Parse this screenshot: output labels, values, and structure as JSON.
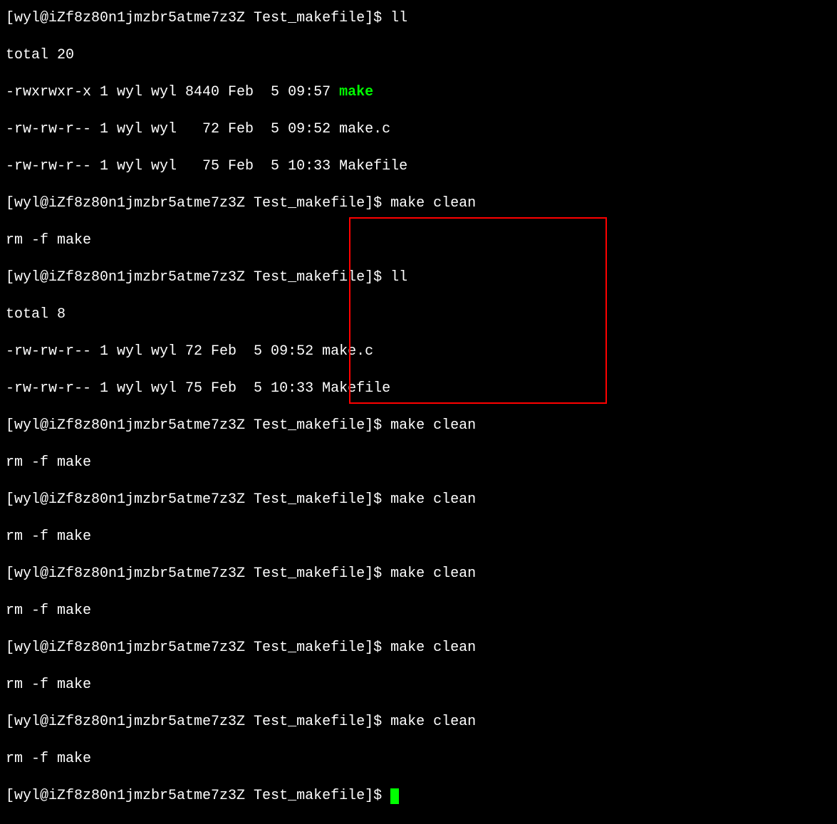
{
  "lines": {
    "l0_partial": "[wyl@iZf8z80n1jmzbr5atme7z3Z Test_makefile]$ ll",
    "l1": "total 20",
    "l2_perm": "-rwxrwxr-x 1 wyl wyl 8440 Feb  5 09:57 ",
    "l2_file": "make",
    "l3": "-rw-rw-r-- 1 wyl wyl   72 Feb  5 09:52 make.c",
    "l4": "-rw-rw-r-- 1 wyl wyl   75 Feb  5 10:33 Makefile",
    "l5": "[wyl@iZf8z80n1jmzbr5atme7z3Z Test_makefile]$ make clean",
    "l6": "rm -f make",
    "l7": "[wyl@iZf8z80n1jmzbr5atme7z3Z Test_makefile]$ ll",
    "l8": "total 8",
    "l9": "-rw-rw-r-- 1 wyl wyl 72 Feb  5 09:52 make.c",
    "l10": "-rw-rw-r-- 1 wyl wyl 75 Feb  5 10:33 Makefile",
    "l11": "[wyl@iZf8z80n1jmzbr5atme7z3Z Test_makefile]$ make clean",
    "l12": "rm -f make",
    "l13": "[wyl@iZf8z80n1jmzbr5atme7z3Z Test_makefile]$ make clean",
    "l14": "rm -f make",
    "l15": "[wyl@iZf8z80n1jmzbr5atme7z3Z Test_makefile]$ make clean",
    "l16": "rm -f make",
    "l17": "[wyl@iZf8z80n1jmzbr5atme7z3Z Test_makefile]$ make clean",
    "l18": "rm -f make",
    "l19": "[wyl@iZf8z80n1jmzbr5atme7z3Z Test_makefile]$ make clean",
    "l20": "rm -f make",
    "l21": "[wyl@iZf8z80n1jmzbr5atme7z3Z Test_makefile]$ "
  }
}
